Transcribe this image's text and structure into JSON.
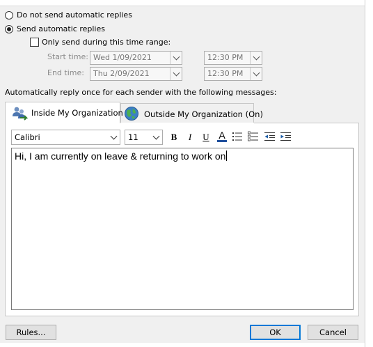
{
  "options": {
    "no_auto_reply": "Do not send automatic replies",
    "send_auto_reply": "Send automatic replies",
    "time_range": "Only send during this time range:"
  },
  "schedule": {
    "start_label": "Start time:",
    "start_date": "Wed 1/09/2021",
    "start_time": "12:30 PM",
    "end_label": "End time:",
    "end_date": "Thu 2/09/2021",
    "end_time": "12:30 PM"
  },
  "instruction": "Automatically reply once for each sender with the following messages:",
  "tabs": {
    "inside": "Inside My Organization",
    "outside": "Outside My Organization (On)"
  },
  "format": {
    "font": "Calibri",
    "size": "11",
    "bold": "B",
    "italic": "I",
    "underline": "U",
    "font_color": "A"
  },
  "message": "Hi, I am currently on leave & returning to work on",
  "buttons": {
    "rules": "Rules...",
    "ok": "OK",
    "cancel": "Cancel"
  },
  "colors": {
    "accent": "#0078d7",
    "font_color_bar": "#1f4e9c"
  },
  "icons": {
    "inside_tab": "people-organization-icon",
    "outside_tab": "globe-icon"
  }
}
